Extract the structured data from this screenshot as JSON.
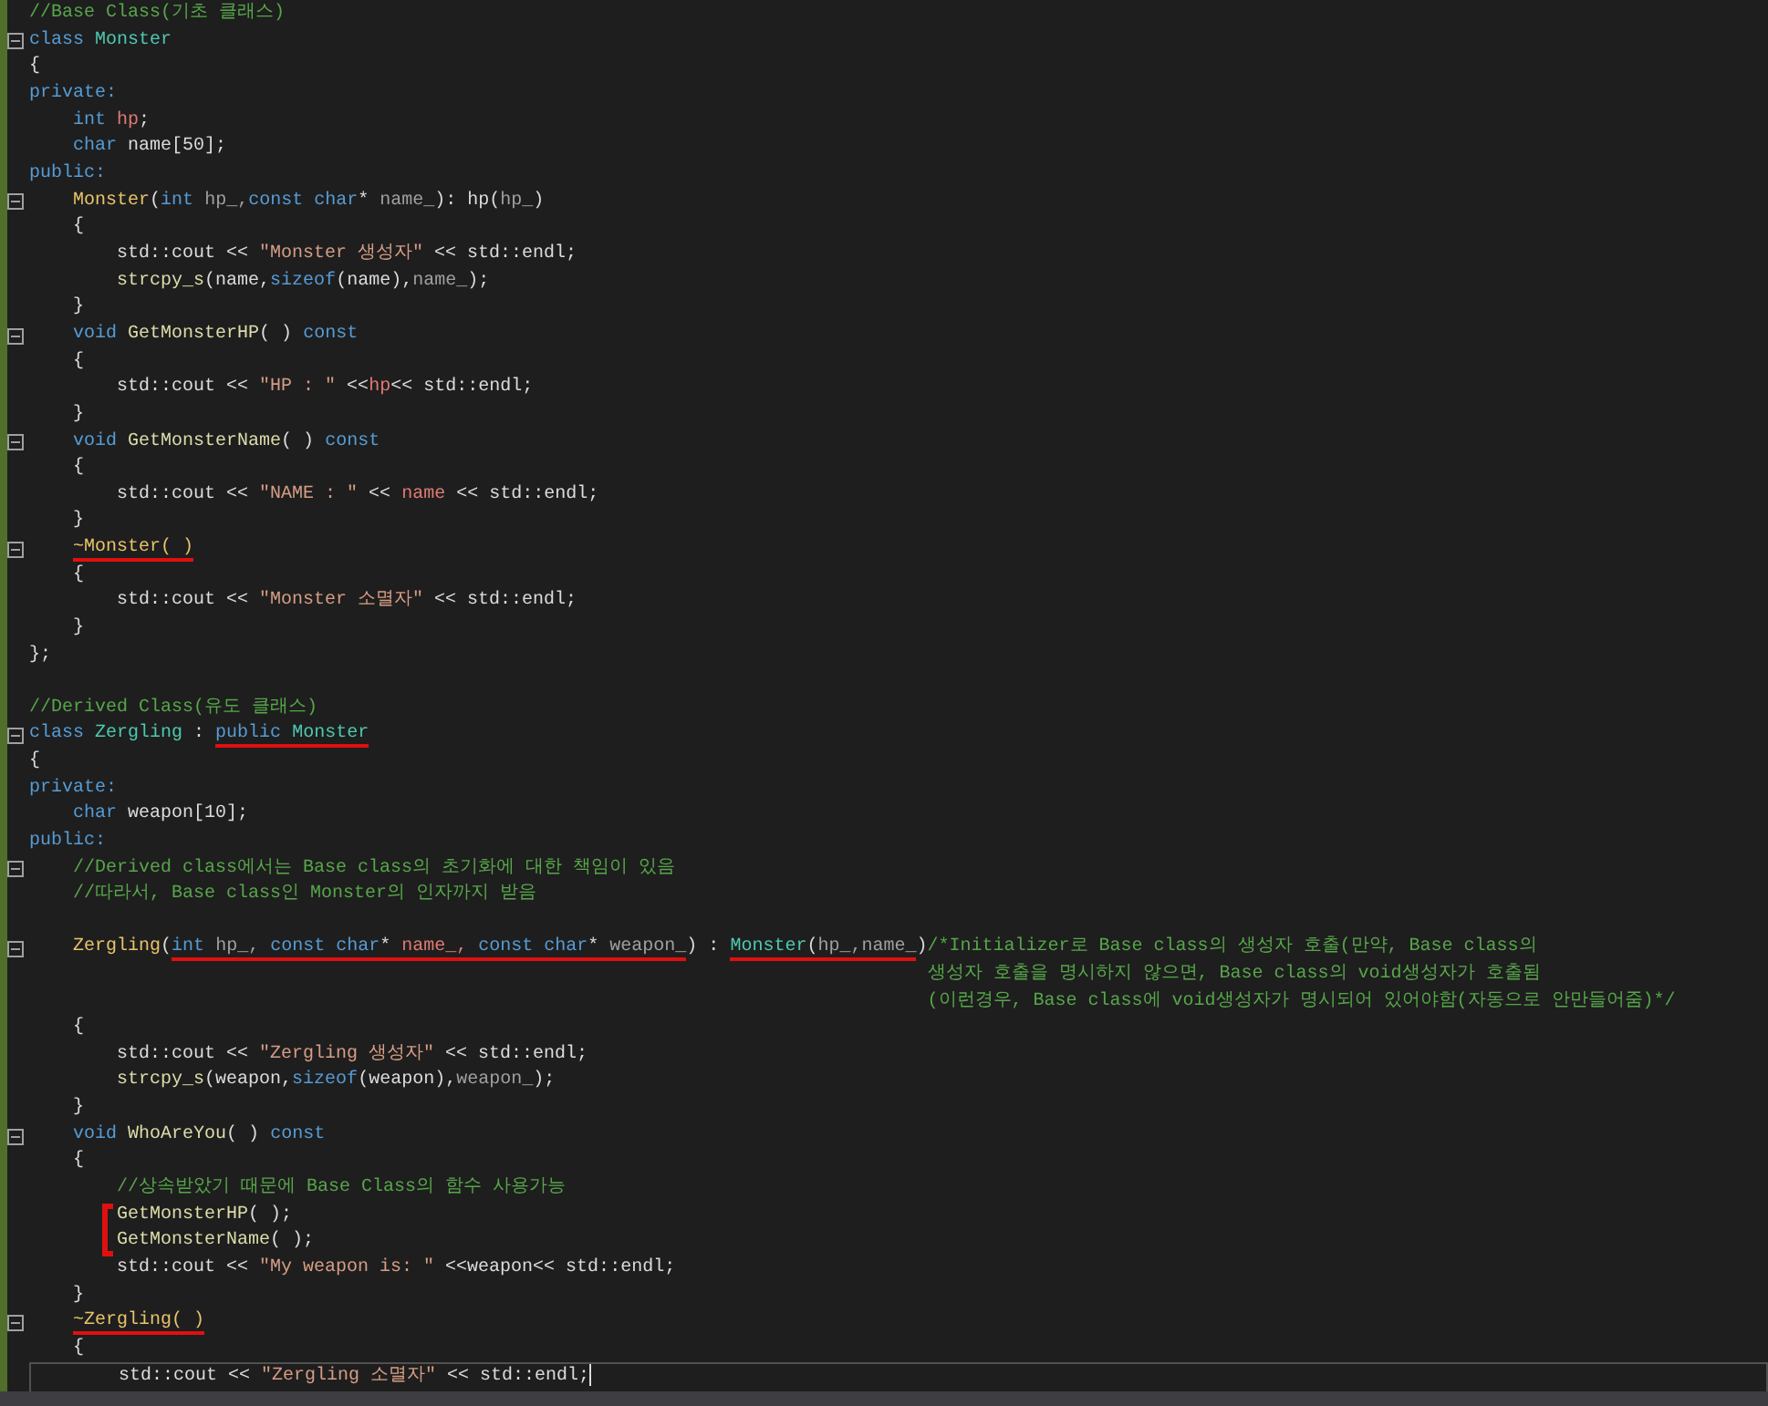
{
  "lines": [
    {
      "tokens": [
        {
          "text": "//Base Class(기초 클래스)",
          "kind": "com"
        }
      ]
    },
    {
      "foldable": true,
      "tokens": [
        {
          "text": "class ",
          "kind": "kw"
        },
        {
          "text": "Monster",
          "kind": "type"
        }
      ]
    },
    {
      "tokens": [
        {
          "text": "{",
          "kind": "plain"
        }
      ]
    },
    {
      "tokens": [
        {
          "text": "private:",
          "kind": "kw"
        }
      ]
    },
    {
      "tokens": [
        {
          "text": "    int ",
          "kind": "kw"
        },
        {
          "text": "hp",
          "kind": "member"
        },
        {
          "text": ";",
          "kind": "plain"
        }
      ]
    },
    {
      "tokens": [
        {
          "text": "    char ",
          "kind": "kw"
        },
        {
          "text": "name[50];",
          "kind": "plain"
        }
      ]
    },
    {
      "tokens": [
        {
          "text": "public:",
          "kind": "kw"
        }
      ]
    },
    {
      "foldable": true,
      "tokens": [
        {
          "text": "    Monster",
          "kind": "ctor"
        },
        {
          "text": "(",
          "kind": "plain"
        },
        {
          "text": "int",
          "kind": "kw"
        },
        {
          "text": " hp_,",
          "kind": "param"
        },
        {
          "text": "const char",
          "kind": "kw"
        },
        {
          "text": "*",
          "kind": "plain"
        },
        {
          "text": " name_",
          "kind": "param"
        },
        {
          "text": "): hp(",
          "kind": "plain"
        },
        {
          "text": "hp_",
          "kind": "param"
        },
        {
          "text": ")",
          "kind": "plain"
        }
      ]
    },
    {
      "tokens": [
        {
          "text": "    {",
          "kind": "plain"
        }
      ]
    },
    {
      "tokens": [
        {
          "text": "        std::cout << ",
          "kind": "plain"
        },
        {
          "text": "\"Monster 생성자\"",
          "kind": "str"
        },
        {
          "text": " << std::endl;",
          "kind": "plain"
        }
      ]
    },
    {
      "tokens": [
        {
          "text": "        strcpy_s",
          "kind": "fn"
        },
        {
          "text": "(name,",
          "kind": "plain"
        },
        {
          "text": "sizeof",
          "kind": "kw"
        },
        {
          "text": "(name),",
          "kind": "plain"
        },
        {
          "text": "name_",
          "kind": "param"
        },
        {
          "text": ");",
          "kind": "plain"
        }
      ]
    },
    {
      "tokens": [
        {
          "text": "    }",
          "kind": "plain"
        }
      ]
    },
    {
      "foldable": true,
      "tokens": [
        {
          "text": "    void ",
          "kind": "kw"
        },
        {
          "text": "GetMonsterHP",
          "kind": "fn"
        },
        {
          "text": "( ) ",
          "kind": "plain"
        },
        {
          "text": "const",
          "kind": "kw"
        }
      ]
    },
    {
      "tokens": [
        {
          "text": "    {",
          "kind": "plain"
        }
      ]
    },
    {
      "tokens": [
        {
          "text": "        std::cout << ",
          "kind": "plain"
        },
        {
          "text": "\"HP : \"",
          "kind": "str"
        },
        {
          "text": " <<",
          "kind": "plain"
        },
        {
          "text": "hp",
          "kind": "member"
        },
        {
          "text": "<< std::endl;",
          "kind": "plain"
        }
      ]
    },
    {
      "tokens": [
        {
          "text": "    }",
          "kind": "plain"
        }
      ]
    },
    {
      "foldable": true,
      "tokens": [
        {
          "text": "    void ",
          "kind": "kw"
        },
        {
          "text": "GetMonsterName",
          "kind": "fn"
        },
        {
          "text": "( ) ",
          "kind": "plain"
        },
        {
          "text": "const",
          "kind": "kw"
        }
      ]
    },
    {
      "tokens": [
        {
          "text": "    {",
          "kind": "plain"
        }
      ]
    },
    {
      "tokens": [
        {
          "text": "        std::cout << ",
          "kind": "plain"
        },
        {
          "text": "\"NAME : \"",
          "kind": "str"
        },
        {
          "text": " << ",
          "kind": "plain"
        },
        {
          "text": "name",
          "kind": "member"
        },
        {
          "text": " << std::endl;",
          "kind": "plain"
        }
      ]
    },
    {
      "tokens": [
        {
          "text": "    }",
          "kind": "plain"
        }
      ]
    },
    {
      "foldable": true,
      "tokens": [
        {
          "text": "    ~Monster( )",
          "kind": "ctor",
          "underlined": true
        }
      ]
    },
    {
      "tokens": [
        {
          "text": "    {",
          "kind": "plain"
        }
      ]
    },
    {
      "tokens": [
        {
          "text": "        std::cout << ",
          "kind": "plain"
        },
        {
          "text": "\"Monster 소멸자\"",
          "kind": "str"
        },
        {
          "text": " << std::endl;",
          "kind": "plain"
        }
      ]
    },
    {
      "tokens": [
        {
          "text": "    }",
          "kind": "plain"
        }
      ]
    },
    {
      "tokens": [
        {
          "text": "};",
          "kind": "plain"
        }
      ]
    },
    {
      "blank_line_before": true,
      "tokens": [
        {
          "text": "//Derived Class(유도 클래스)",
          "kind": "com"
        }
      ]
    },
    {
      "foldable": true,
      "tokens": [
        {
          "text": "class ",
          "kind": "kw"
        },
        {
          "text": "Zergling",
          "kind": "type"
        },
        {
          "text": " : ",
          "kind": "plain"
        },
        {
          "text": "public",
          "kind": "kw",
          "underlined": true
        },
        {
          "text": " Monster",
          "kind": "type",
          "underlined": true
        }
      ]
    },
    {
      "tokens": [
        {
          "text": "{",
          "kind": "plain"
        }
      ]
    },
    {
      "tokens": [
        {
          "text": "private:",
          "kind": "kw"
        }
      ]
    },
    {
      "tokens": [
        {
          "text": "    char ",
          "kind": "kw"
        },
        {
          "text": "weapon[10];",
          "kind": "plain"
        }
      ]
    },
    {
      "tokens": [
        {
          "text": "public:",
          "kind": "kw"
        }
      ]
    },
    {
      "foldable": true,
      "tokens": [
        {
          "text": "    //Derived class에서는 Base class의 초기화에 대한 책임이 있음",
          "kind": "com"
        }
      ]
    },
    {
      "tokens": [
        {
          "text": "    //따라서, Base class인 Monster의 인자까지 받음",
          "kind": "com"
        }
      ]
    },
    {
      "blank_line_before": true,
      "foldable": true,
      "tokens": [
        {
          "text": "    Zergling",
          "kind": "ctor"
        },
        {
          "text": "(",
          "kind": "plain"
        },
        {
          "text": "int",
          "kind": "kw",
          "underlined": true
        },
        {
          "text": " hp_, ",
          "kind": "param",
          "underlined": true
        },
        {
          "text": "const char",
          "kind": "kw",
          "underlined": true
        },
        {
          "text": "*",
          "kind": "plain",
          "underlined": true
        },
        {
          "text": " name_, ",
          "kind": "member",
          "underlined": true
        },
        {
          "text": "const char",
          "kind": "kw",
          "underlined": true
        },
        {
          "text": "*",
          "kind": "plain",
          "underlined": true
        },
        {
          "text": " weapon_",
          "kind": "param",
          "underlined": true
        },
        {
          "text": ") : ",
          "kind": "plain"
        },
        {
          "text": "Monster",
          "kind": "type",
          "underlined": true
        },
        {
          "text": "(",
          "kind": "plain",
          "underlined": true
        },
        {
          "text": "hp_,name_",
          "kind": "param",
          "underlined": true
        },
        {
          "text": ")",
          "kind": "plain"
        },
        {
          "kind": "com_block",
          "lines": [
            "/*Initializer로 Base class의 생성자 호출(만약, Base class의",
            "생성자 호출을 명시하지 않으면, Base class의 void생성자가 호출됨",
            "(이런경우, Base class에 void생성자가 명시되어 있어야함(자동으로 안만들어줌)*/"
          ]
        }
      ]
    },
    {
      "tokens": [
        {
          "text": "    {",
          "kind": "plain"
        }
      ]
    },
    {
      "tokens": [
        {
          "text": "        std::cout << ",
          "kind": "plain"
        },
        {
          "text": "\"Zergling 생성자\"",
          "kind": "str"
        },
        {
          "text": " << std::endl;",
          "kind": "plain"
        }
      ]
    },
    {
      "tokens": [
        {
          "text": "        strcpy_s",
          "kind": "fn"
        },
        {
          "text": "(weapon,",
          "kind": "plain"
        },
        {
          "text": "sizeof",
          "kind": "kw"
        },
        {
          "text": "(weapon),",
          "kind": "plain"
        },
        {
          "text": "weapon_",
          "kind": "param"
        },
        {
          "text": ");",
          "kind": "plain"
        }
      ]
    },
    {
      "tokens": [
        {
          "text": "    }",
          "kind": "plain"
        }
      ]
    },
    {
      "foldable": true,
      "tokens": [
        {
          "text": "    void ",
          "kind": "kw"
        },
        {
          "text": "WhoAreYou",
          "kind": "fn"
        },
        {
          "text": "( ) ",
          "kind": "plain"
        },
        {
          "text": "const",
          "kind": "kw"
        }
      ]
    },
    {
      "tokens": [
        {
          "text": "    {",
          "kind": "plain"
        }
      ]
    },
    {
      "tokens": [
        {
          "text": "        //상속받았기 때문에 Base Class의 함수 사용가능",
          "kind": "com"
        }
      ]
    },
    {
      "bracketed": true,
      "tokens": [
        {
          "text": "        GetMonsterHP",
          "kind": "fn"
        },
        {
          "text": "( );",
          "kind": "plain"
        }
      ]
    },
    {
      "bracketed": true,
      "tokens": [
        {
          "text": "        GetMonsterName",
          "kind": "fn"
        },
        {
          "text": "( );",
          "kind": "plain"
        }
      ]
    },
    {
      "tokens": [
        {
          "text": "        std::cout << ",
          "kind": "plain"
        },
        {
          "text": "\"My weapon is: \"",
          "kind": "str"
        },
        {
          "text": " <<weapon<< std::endl;",
          "kind": "plain"
        }
      ]
    },
    {
      "tokens": [
        {
          "text": "    }",
          "kind": "plain"
        }
      ]
    },
    {
      "foldable": true,
      "tokens": [
        {
          "text": "    ~Zergling( )",
          "kind": "ctor",
          "underlined": true
        }
      ]
    },
    {
      "tokens": [
        {
          "text": "    {",
          "kind": "plain"
        }
      ]
    },
    {
      "current": true,
      "tokens": [
        {
          "text": "        std::cout << ",
          "kind": "plain"
        },
        {
          "text": "\"Zergling 소멸자\"",
          "kind": "str"
        },
        {
          "text": " << std::endl;",
          "kind": "plain"
        }
      ]
    }
  ]
}
